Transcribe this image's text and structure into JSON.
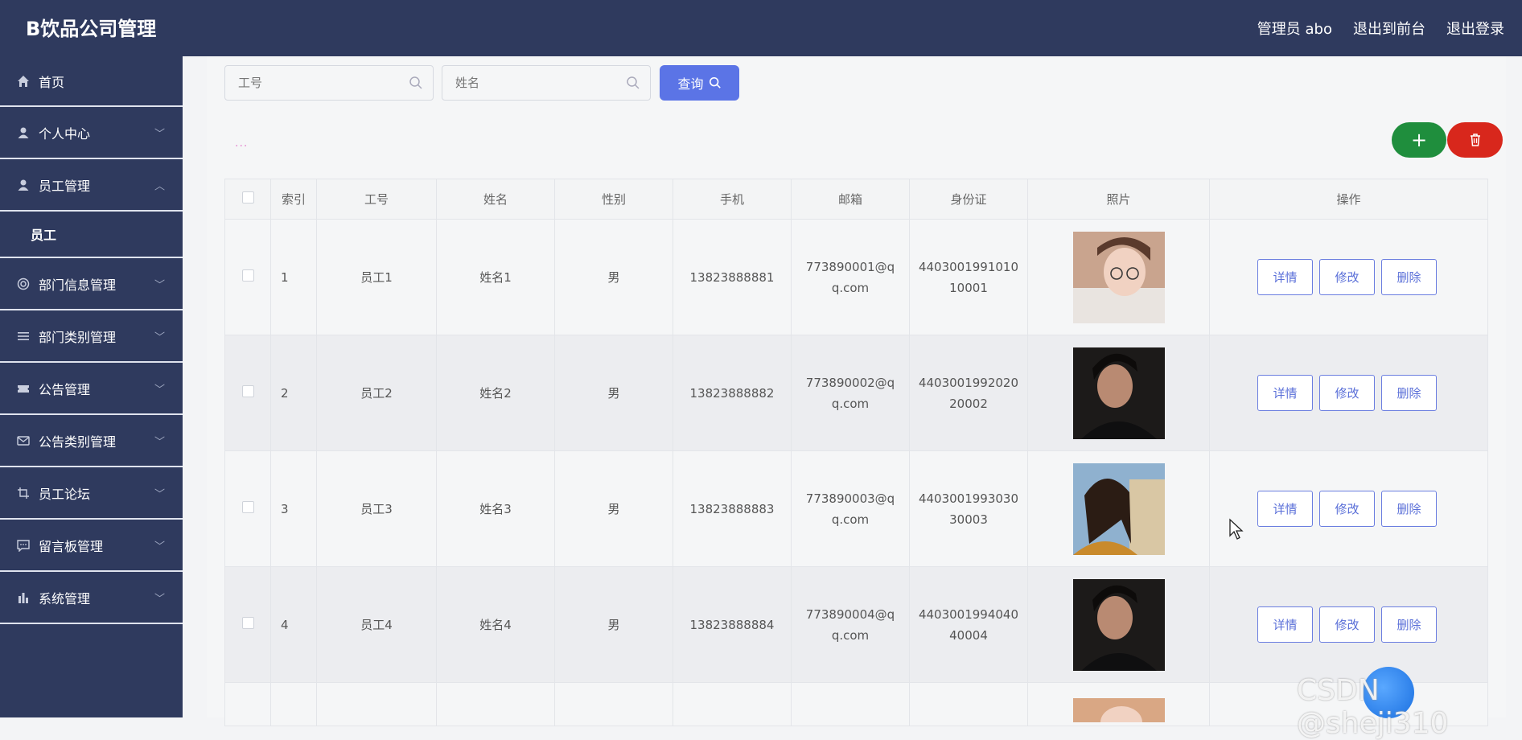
{
  "header": {
    "title": "B饮品公司管理",
    "admin_label": "管理员 abo",
    "back_to_front": "退出到前台",
    "logout": "退出登录"
  },
  "sidebar": {
    "items": [
      {
        "label": "首页",
        "icon": "home-icon"
      },
      {
        "label": "个人中心",
        "icon": "user-icon"
      },
      {
        "label": "员工管理",
        "icon": "user-icon"
      },
      {
        "label": "员工",
        "icon": ""
      },
      {
        "label": "部门信息管理",
        "icon": "settings-icon"
      },
      {
        "label": "部门类别管理",
        "icon": "list-icon"
      },
      {
        "label": "公告管理",
        "icon": "ticket-icon"
      },
      {
        "label": "公告类别管理",
        "icon": "mail-icon"
      },
      {
        "label": "员工论坛",
        "icon": "crop-icon"
      },
      {
        "label": "留言板管理",
        "icon": "chat-icon"
      },
      {
        "label": "系统管理",
        "icon": "bar-chart-icon"
      }
    ]
  },
  "search": {
    "id_placeholder": "工号",
    "name_placeholder": "姓名",
    "button_label": "查询"
  },
  "toolbar": {
    "dots": "···"
  },
  "table": {
    "columns": [
      "索引",
      "工号",
      "姓名",
      "性别",
      "手机",
      "邮箱",
      "身份证",
      "照片",
      "操作"
    ],
    "rows": [
      {
        "index": "1",
        "emp_id": "员工1",
        "name": "姓名1",
        "gender": "男",
        "phone": "13823888881",
        "email_1": "773890001@q",
        "email_2": "q.com",
        "id_1": "4403001991010",
        "id_2": "10001"
      },
      {
        "index": "2",
        "emp_id": "员工2",
        "name": "姓名2",
        "gender": "男",
        "phone": "13823888882",
        "email_1": "773890002@q",
        "email_2": "q.com",
        "id_1": "4403001992020",
        "id_2": "20002"
      },
      {
        "index": "3",
        "emp_id": "员工3",
        "name": "姓名3",
        "gender": "男",
        "phone": "13823888883",
        "email_1": "773890003@q",
        "email_2": "q.com",
        "id_1": "4403001993030",
        "id_2": "30003"
      },
      {
        "index": "4",
        "emp_id": "员工4",
        "name": "姓名4",
        "gender": "男",
        "phone": "13823888884",
        "email_1": "773890004@q",
        "email_2": "q.com",
        "id_1": "4403001994040",
        "id_2": "40004"
      }
    ],
    "actions": {
      "detail": "详情",
      "edit": "修改",
      "delete": "删除"
    }
  },
  "watermark": "CSDN @sheji310",
  "colors": {
    "sidebar_bg": "#2f3a5e",
    "primary": "#5b74e6",
    "add": "#1f8e3d",
    "danger": "#d8271c"
  }
}
